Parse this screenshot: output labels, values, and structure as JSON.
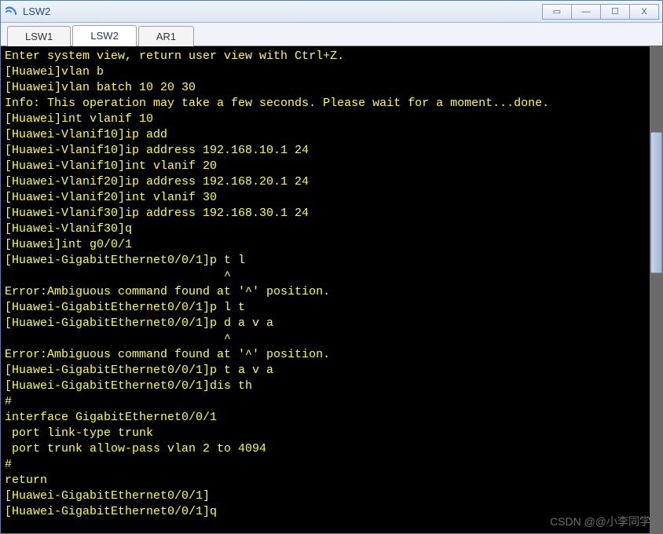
{
  "window": {
    "title": "LSW2"
  },
  "tabs": [
    {
      "label": "LSW1",
      "active": false
    },
    {
      "label": "LSW2",
      "active": true
    },
    {
      "label": "AR1",
      "active": false
    }
  ],
  "winControls": {
    "extra": "▭",
    "minimize": "—",
    "maximize": "☐",
    "close": "X"
  },
  "terminal": {
    "lines": [
      "Enter system view, return user view with Ctrl+Z.",
      "[Huawei]vlan b",
      "[Huawei]vlan batch 10 20 30",
      "Info: This operation may take a few seconds. Please wait for a moment...done.",
      "[Huawei]int vlanif 10",
      "[Huawei-Vlanif10]ip add",
      "[Huawei-Vlanif10]ip address 192.168.10.1 24",
      "[Huawei-Vlanif10]int vlanif 20",
      "[Huawei-Vlanif20]ip address 192.168.20.1 24",
      "[Huawei-Vlanif20]int vlanif 30",
      "[Huawei-Vlanif30]ip address 192.168.30.1 24",
      "[Huawei-Vlanif30]q",
      "[Huawei]int g0/0/1",
      "[Huawei-GigabitEthernet0/0/1]p t l",
      "                               ^",
      "Error:Ambiguous command found at '^' position.",
      "[Huawei-GigabitEthernet0/0/1]p l t",
      "[Huawei-GigabitEthernet0/0/1]p d a v a",
      "                               ^",
      "Error:Ambiguous command found at '^' position.",
      "[Huawei-GigabitEthernet0/0/1]p t a v a",
      "[Huawei-GigabitEthernet0/0/1]dis th",
      "#",
      "interface GigabitEthernet0/0/1",
      " port link-type trunk",
      " port trunk allow-pass vlan 2 to 4094",
      "#",
      "return",
      "[Huawei-GigabitEthernet0/0/1]",
      "[Huawei-GigabitEthernet0/0/1]q"
    ]
  },
  "watermark": "CSDN @@小李同学"
}
